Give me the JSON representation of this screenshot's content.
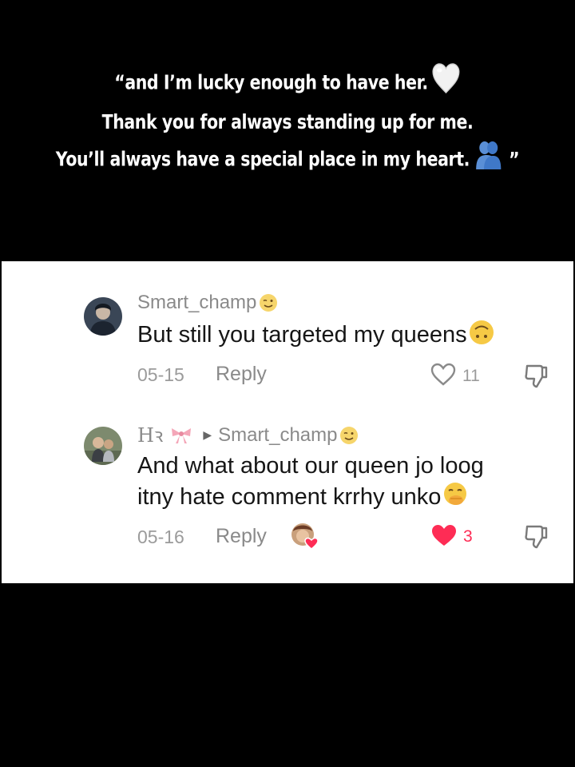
{
  "caption": {
    "line1": "“and I’m lucky enough to have her.",
    "line2": "Thank you for always standing up for me.",
    "line3": "You’ll always have a special place in my heart.",
    "closing_quote": "”",
    "line1_emoji": "white-heart-icon",
    "line3_emoji": "people-hugging-icon"
  },
  "comments": [
    {
      "username": "Smart_champ",
      "username_emoji": "winking-face-icon",
      "text": "But still you targeted my queens",
      "text_emoji": "upside-down-face-icon",
      "date": "05-15",
      "reply_label": "Reply",
      "likes": "11",
      "liked": false
    },
    {
      "username": "Hꝛ",
      "username_emoji": "ribbon-icon",
      "reply_to": "Smart_champ",
      "reply_to_emoji": "winking-face-icon",
      "text_line1": "And what about our queen jo loog",
      "text_line2": "itny hate comment krrhy unko",
      "text_emoji": "face-with-hand-over-mouth-icon",
      "date": "05-16",
      "reply_label": "Reply",
      "likes": "3",
      "liked": true,
      "creator_liked_icon": "creator-liked-avatar"
    }
  ],
  "colors": {
    "background": "#000000",
    "card": "#ffffff",
    "like_active": "#fe2c55",
    "muted_text": "#8a8a8a"
  }
}
